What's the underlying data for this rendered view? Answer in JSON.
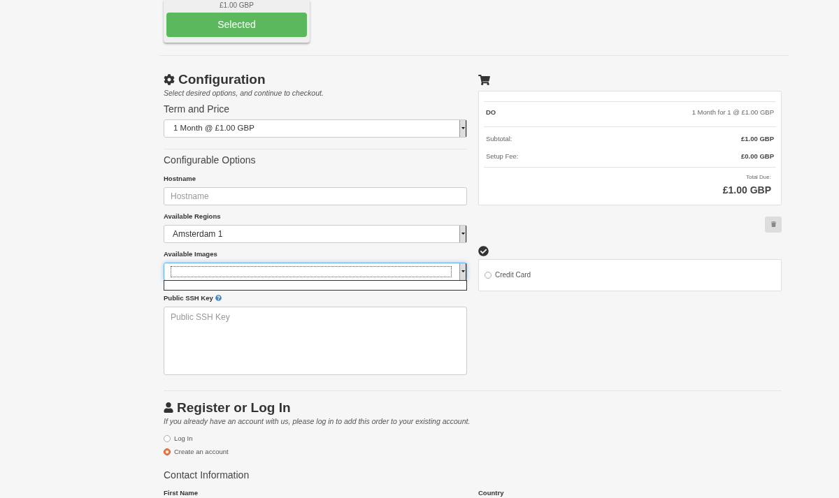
{
  "product_card": {
    "price": "£1.00 GBP",
    "button": "Selected",
    "selected": true
  },
  "configuration": {
    "title": "Configuration",
    "subtitle": "Select desired options, and continue to checkout.",
    "term_label": "Term and Price",
    "term_value": "1 Month @ £1.00 GBP",
    "options_title": "Configurable Options",
    "fields": [
      {
        "kind": "input",
        "label": "Hostname",
        "placeholder": "Hostname"
      },
      {
        "kind": "select",
        "label": "Available Regions",
        "value": "Amsterdam 1"
      },
      {
        "kind": "open-select",
        "label": "Available Images"
      },
      {
        "kind": "textarea",
        "label": "Public SSH Key",
        "help": true,
        "placeholder": "Public SSH Key"
      }
    ]
  },
  "summary": {
    "item_name": "DO",
    "item_detail": "1 Month for 1 @ £1.00 GBP",
    "lines": [
      {
        "label": "Subtotal:",
        "amount": "£1.00 GBP"
      },
      {
        "label": "Setup Fee:",
        "amount": "£0.00 GBP"
      }
    ],
    "total_label": "Total Due:",
    "total": "£1.00 GBP"
  },
  "payment": {
    "methods": [
      {
        "label": "Credit Card",
        "selected": false
      }
    ]
  },
  "register": {
    "title": "Register or Log In",
    "subtitle": "If you already have an account with us, please log in to add this order to your existing account.",
    "options": [
      {
        "label": "Log In",
        "selected": false
      },
      {
        "label": "Create an account",
        "selected": true
      }
    ]
  },
  "contact": {
    "title": "Contact Information",
    "left_label": "First Name",
    "right_label": "Country"
  }
}
